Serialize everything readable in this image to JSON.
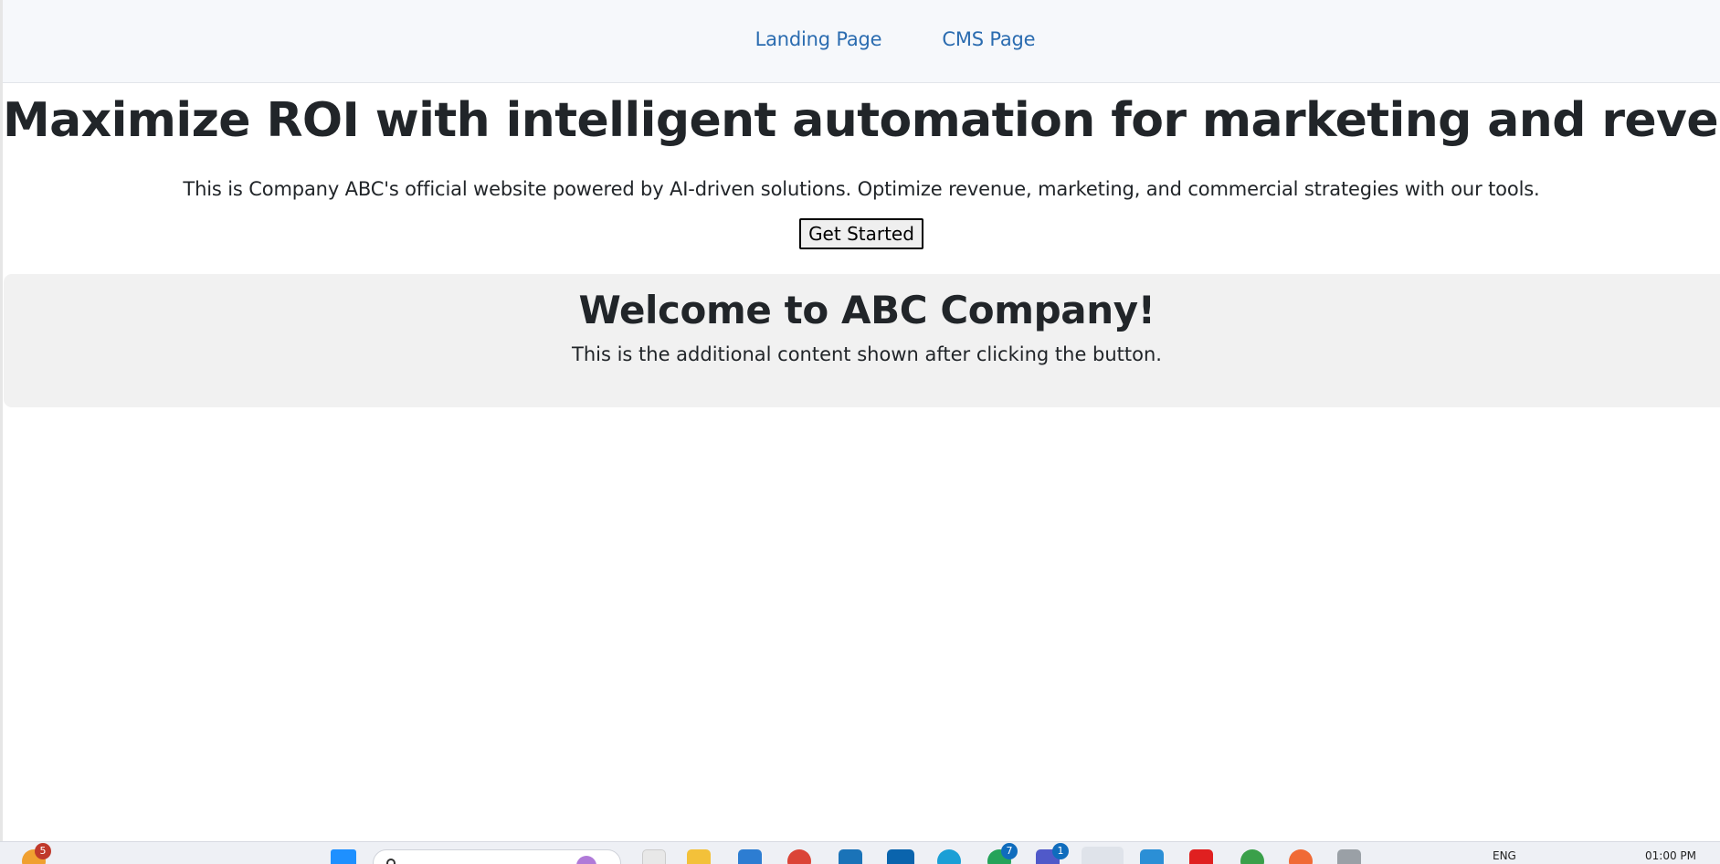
{
  "nav": {
    "links": [
      {
        "label": "Landing Page"
      },
      {
        "label": "CMS Page"
      }
    ]
  },
  "hero": {
    "title": "Maximize ROI with intelligent automation for marketing and revenue.",
    "description": "This is Company ABC's official website powered by AI-driven solutions. Optimize revenue, marketing, and commercial strategies with our tools.",
    "button_label": "Get Started"
  },
  "welcome": {
    "title": "Welcome to ABC Company!",
    "text": "This is the additional content shown after clicking the button."
  },
  "taskbar": {
    "notification_count": "5",
    "badge_whatsapp": "7",
    "badge_mail": "1",
    "language": "ENG",
    "time": "01:00 PM",
    "icons": [
      "weather-icon",
      "windows-start-icon",
      "search-icon",
      "copilot-icon",
      "file-icon",
      "folder-icon",
      "store-icon",
      "chrome-icon",
      "briefcase-icon",
      "outlook-icon",
      "edge-icon",
      "whatsapp-icon",
      "teams-icon",
      "browser-icon",
      "vscode-icon",
      "youtube-icon",
      "settings-icon",
      "brave-icon",
      "app-icon"
    ]
  },
  "colors": {
    "nav_link": "#2b6cb0",
    "text": "#212529",
    "navbar_bg": "#f6f8fb",
    "welcome_bg": "#f1f1f1"
  }
}
